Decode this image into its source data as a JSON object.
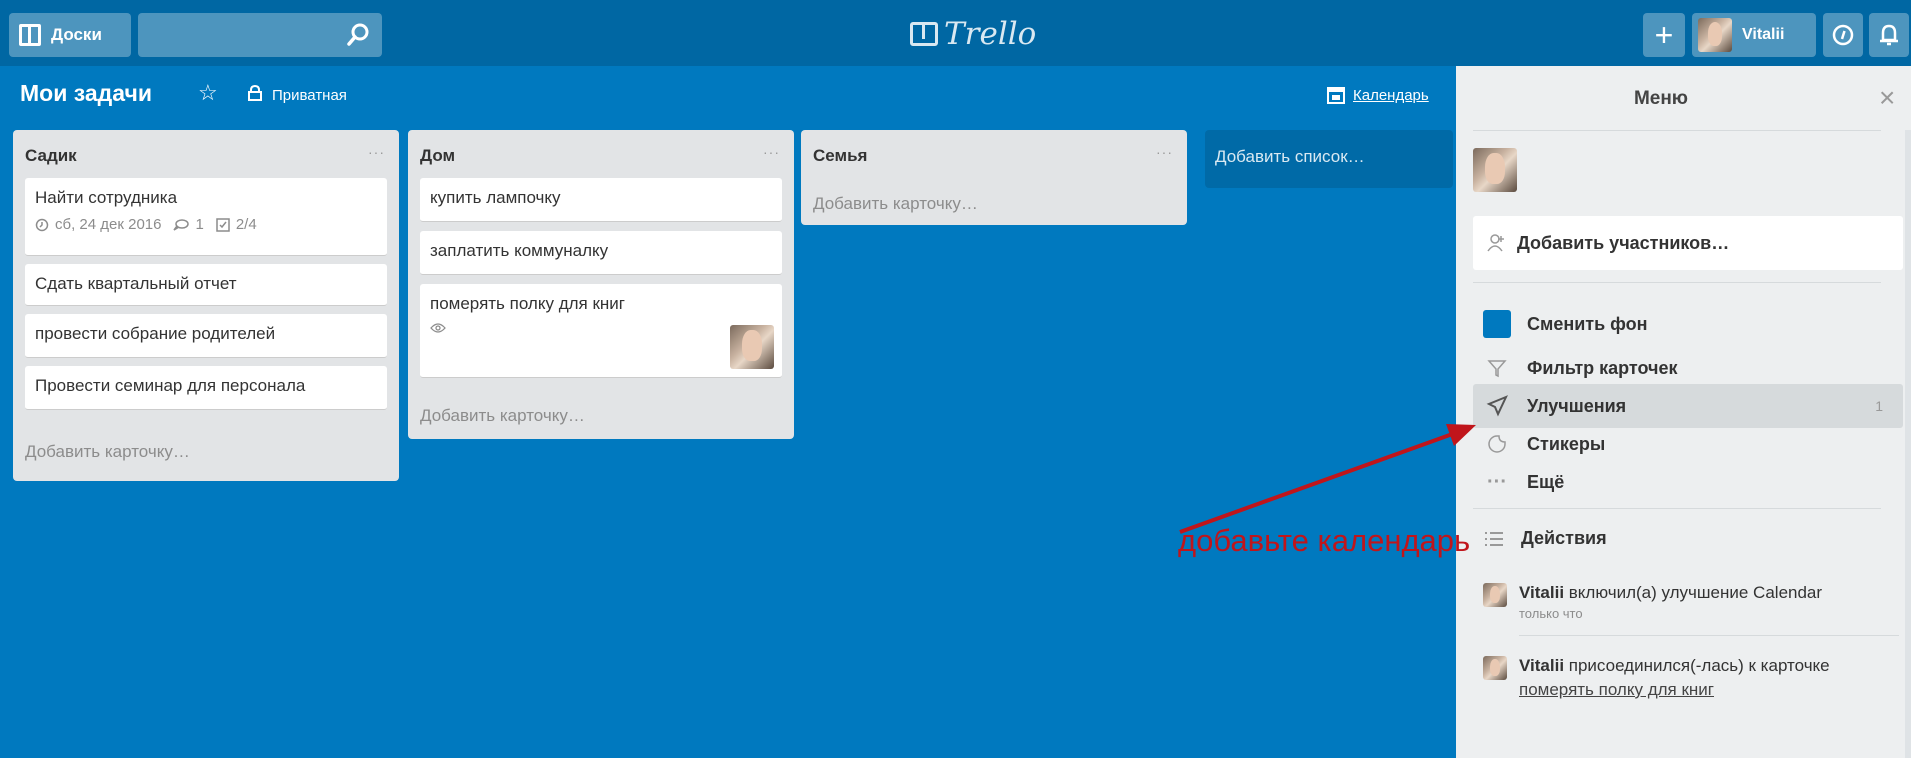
{
  "header": {
    "boards_label": "Доски",
    "logo_text": "Trello",
    "user_name": "Vitalii"
  },
  "board": {
    "title": "Мои задачи",
    "visibility": "Приватная",
    "calendar_link": "Календарь"
  },
  "lists": [
    {
      "title": "Садик",
      "menu": "···",
      "cards": [
        {
          "title": "Найти сотрудника",
          "due": "сб, 24 дек 2016",
          "comments": "1",
          "checklist": "2/4"
        },
        {
          "title": "Сдать квартальный отчет"
        },
        {
          "title": "провести собрание родителей"
        },
        {
          "title": "Провести семинар для персонала"
        }
      ],
      "add_card": "Добавить карточку…"
    },
    {
      "title": "Дом",
      "menu": "···",
      "cards": [
        {
          "title": "купить лампочку"
        },
        {
          "title": "заплатить коммуналку"
        },
        {
          "title": "померять полку для книг"
        }
      ],
      "add_card": "Добавить карточку…"
    },
    {
      "title": "Семья",
      "menu": "···",
      "cards": [],
      "add_card": "Добавить карточку…"
    }
  ],
  "add_list": "Добавить список…",
  "menu": {
    "title": "Меню",
    "close": "×",
    "add_members": "Добавить участников…",
    "items": [
      {
        "label": "Сменить фон"
      },
      {
        "label": "Фильтр карточек"
      },
      {
        "label": "Улучшения",
        "count": "1"
      },
      {
        "label": "Стикеры"
      },
      {
        "label": "Ещё"
      }
    ],
    "activity_title": "Действия",
    "activity": [
      {
        "user": "Vitalii",
        "text": " включил(а) улучшение Calendar",
        "time": "только что"
      },
      {
        "user": "Vitalii",
        "text": " присоединился(-лась) к карточке",
        "link": "померять полку для книг"
      }
    ]
  },
  "annotation": "добавьте календарь",
  "colors": {
    "board_bg": "#0079bf",
    "header_bg": "#0067a3",
    "menu_bg": "#edeff0",
    "annotation": "#c0151b"
  }
}
